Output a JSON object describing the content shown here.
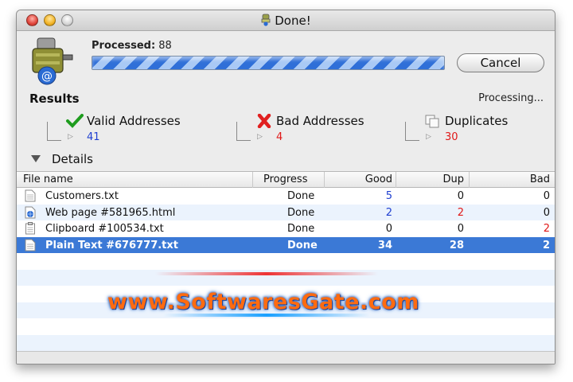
{
  "window": {
    "title": "Done!"
  },
  "top": {
    "processed_label": "Processed:",
    "processed_count": "88",
    "progress_fraction": 1.0,
    "cancel_label": "Cancel"
  },
  "results": {
    "label": "Results",
    "status": "Processing..."
  },
  "summary": [
    {
      "label": "Valid Addresses",
      "count": "41",
      "count_color": "#1f3fd0",
      "icon": "check-icon"
    },
    {
      "label": "Bad Addresses",
      "count": "4",
      "count_color": "#e01818",
      "icon": "x-icon"
    },
    {
      "label": "Duplicates",
      "count": "30",
      "count_color": "#e01818",
      "icon": "duplicate-icon"
    }
  ],
  "details": {
    "label": "Details"
  },
  "table": {
    "columns": [
      "File name",
      "Progress",
      "Good",
      "Dup",
      "Bad"
    ],
    "rows": [
      {
        "name": "Customers.txt",
        "progress": "Done",
        "good": "5",
        "dup": "0",
        "bad": "0",
        "icon": "text-file-icon"
      },
      {
        "name": "Web page #581965.html",
        "progress": "Done",
        "good": "2",
        "dup": "2",
        "bad": "0",
        "icon": "web-page-icon"
      },
      {
        "name": "Clipboard #100534.txt",
        "progress": "Done",
        "good": "0",
        "dup": "0",
        "bad": "2",
        "icon": "clipboard-icon"
      },
      {
        "name": "Plain Text #676777.txt",
        "progress": "Done",
        "good": "34",
        "dup": "28",
        "bad": "2",
        "icon": "text-file-icon",
        "selected": true
      }
    ]
  },
  "watermark": {
    "text": "www.SoftwaresGate.com"
  },
  "colors": {
    "accent_blue": "#1f3fd0",
    "error_red": "#e01818",
    "selection": "#3b79d6"
  }
}
